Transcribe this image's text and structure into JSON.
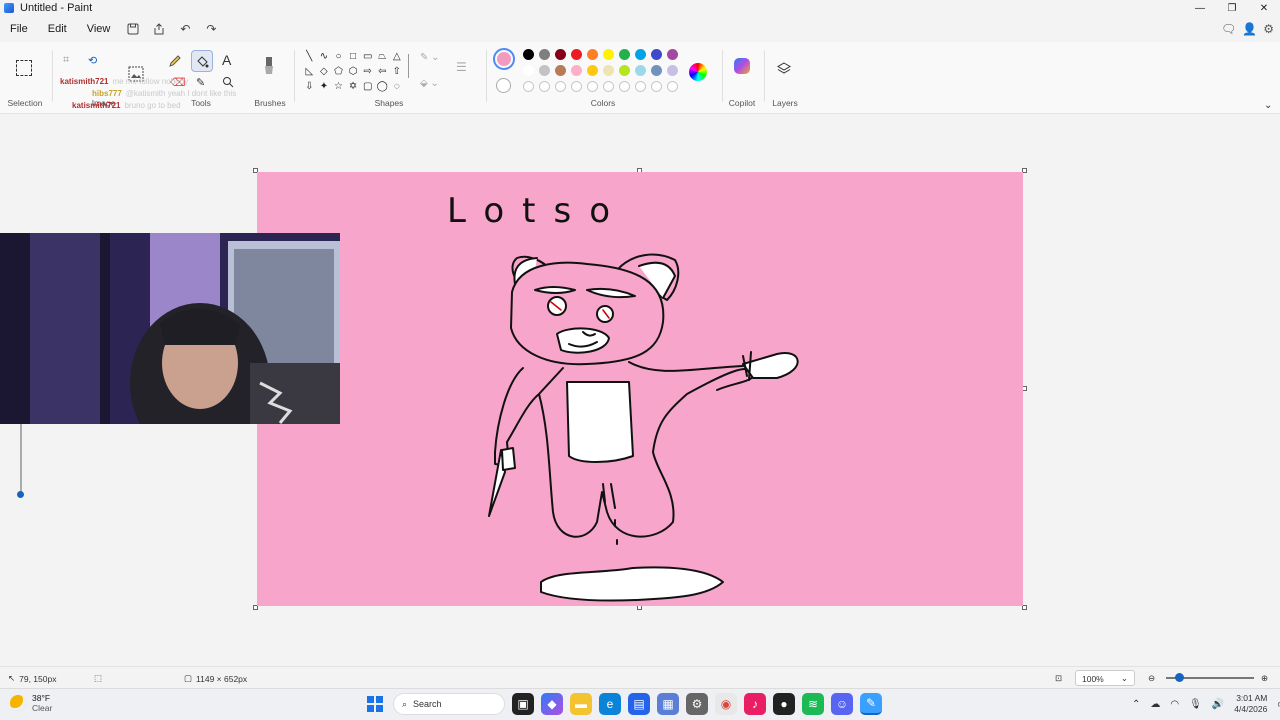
{
  "window": {
    "title": "Untitled - Paint"
  },
  "menu": {
    "file": "File",
    "edit": "Edit",
    "view": "View"
  },
  "ribbon": {
    "selection_label": "Selection",
    "image_label": "Image",
    "tools_label": "Tools",
    "brushes_label": "Brushes",
    "shapes_label": "Shapes",
    "colors_label": "Colors",
    "copilot_label": "Copilot",
    "layers_label": "Layers"
  },
  "colors": {
    "current_primary": "#f29bc0",
    "row1": [
      "#000000",
      "#7f7f7f",
      "#880015",
      "#ed1c24",
      "#ff7f27",
      "#fff200",
      "#22b14c",
      "#00a2e8",
      "#3f48cc",
      "#a349a4"
    ],
    "row2": [
      "#ffffff",
      "#c3c3c3",
      "#b97a57",
      "#ffaec9",
      "#ffc90e",
      "#efe4b0",
      "#b5e61d",
      "#99d9ea",
      "#7092be",
      "#c8bfe7"
    ]
  },
  "chat": [
    {
      "user": "katismith721",
      "message": "me me follow nobody",
      "color": "#b03030"
    },
    {
      "user": "hibs777",
      "message": "@katismith yeah I dont like this",
      "color": "#c9a227"
    },
    {
      "user": "katismith721",
      "message": "bruno go to bed",
      "color": "#b03030"
    }
  ],
  "canvas": {
    "drawing_text": "Lotso",
    "background": "#f7a5ca"
  },
  "status": {
    "cursor_position": "79, 150px",
    "canvas_size": "1149 × 652px",
    "zoom": "100%"
  },
  "taskbar": {
    "weather_temp": "38°F",
    "weather_desc": "Clear",
    "search_placeholder": "Search",
    "time": "3:01 AM",
    "date": "4/4/2026"
  }
}
